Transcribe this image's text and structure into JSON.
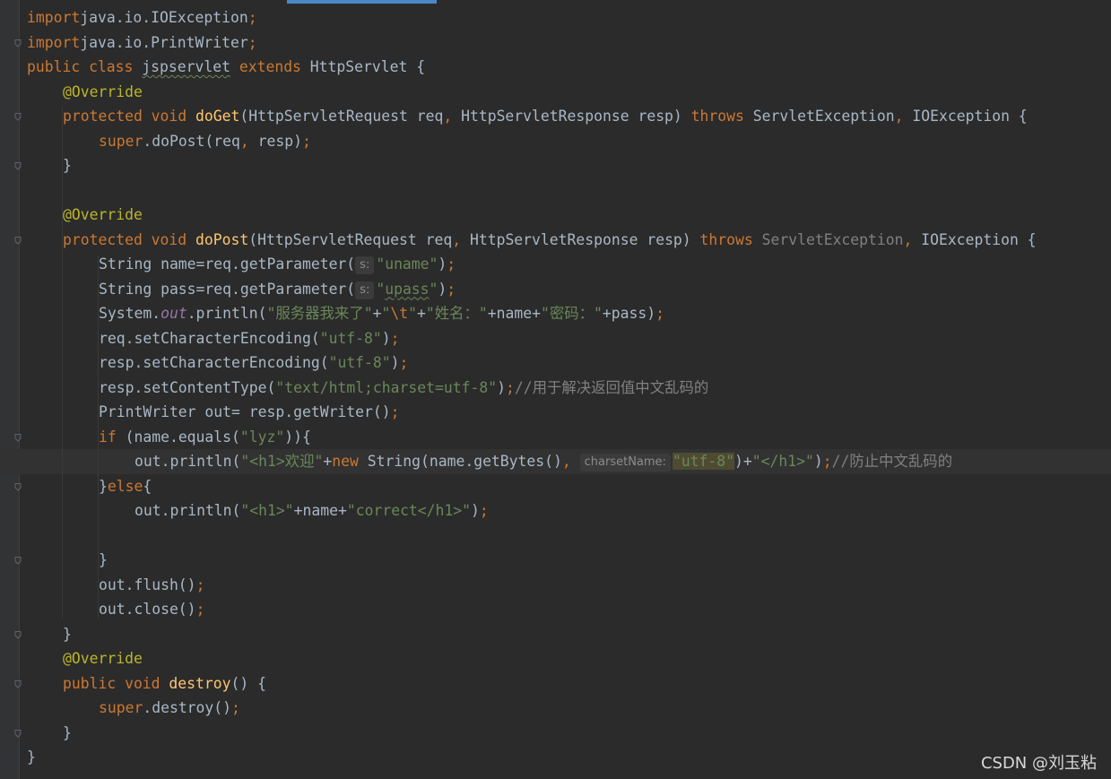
{
  "editor": {
    "lines": [
      [
        [
          "kw",
          "import"
        ],
        [
          "",
          "java.io.IOException"
        ],
        [
          "kw",
          ";"
        ]
      ],
      [
        [
          "kw",
          "import"
        ],
        [
          "",
          "java.io.PrintWriter"
        ],
        [
          "kw",
          ";"
        ]
      ],
      [
        [
          "kw",
          "public class "
        ],
        [
          "squig",
          "jspservlet"
        ],
        [
          "kw",
          " extends "
        ],
        [
          "",
          "HttpServlet {"
        ]
      ],
      [
        [
          "ann",
          "@Override"
        ]
      ],
      [
        [
          "kw",
          "protected void "
        ],
        [
          "fn",
          "doGet"
        ],
        [
          "",
          "(HttpServletRequest req"
        ],
        [
          "kw",
          ", "
        ],
        [
          "",
          "HttpServletResponse resp) "
        ],
        [
          "kw",
          "throws "
        ],
        [
          "",
          "ServletException"
        ],
        [
          "kw",
          ", "
        ],
        [
          "",
          "IOException {"
        ]
      ],
      [
        [
          "kw",
          "super"
        ],
        [
          "",
          ".doPost(req"
        ],
        [
          "kw",
          ", "
        ],
        [
          "",
          "resp)"
        ],
        [
          "kw",
          ";"
        ]
      ],
      [
        [
          "",
          "}"
        ]
      ],
      [],
      [
        [
          "ann",
          "@Override"
        ]
      ],
      [
        [
          "kw",
          "protected void "
        ],
        [
          "fn",
          "doPost"
        ],
        [
          "",
          "(HttpServletRequest req"
        ],
        [
          "kw",
          ", "
        ],
        [
          "",
          "HttpServletResponse resp) "
        ],
        [
          "kw",
          "throws "
        ],
        [
          "gray",
          "ServletException"
        ],
        [
          "kw",
          ", "
        ],
        [
          "",
          "IOException {"
        ]
      ],
      [
        [
          "",
          "String name=req.getParameter("
        ],
        [
          "hint",
          "s:"
        ],
        [
          "str",
          "\"uname\""
        ],
        [
          "",
          ")"
        ],
        [
          "kw",
          ";"
        ]
      ],
      [
        [
          "",
          "String pass=req.getParameter("
        ],
        [
          "hint",
          "s:"
        ],
        [
          "str",
          "\""
        ],
        [
          "str squig",
          "upass"
        ],
        [
          "str",
          "\""
        ],
        [
          "",
          ")"
        ],
        [
          "kw",
          ";"
        ]
      ],
      [
        [
          "",
          "System."
        ],
        [
          "fld",
          "out"
        ],
        [
          "",
          ".println("
        ],
        [
          "str",
          "\"服务器我来了\""
        ],
        [
          "",
          "+"
        ],
        [
          "str",
          "\""
        ],
        [
          "esc",
          "\\t"
        ],
        [
          "str",
          "\""
        ],
        [
          "",
          "+"
        ],
        [
          "str",
          "\"姓名：\""
        ],
        [
          "",
          "+name+"
        ],
        [
          "str",
          "\"密码：\""
        ],
        [
          "",
          "+pass)"
        ],
        [
          "kw",
          ";"
        ]
      ],
      [
        [
          "",
          "req.setCharacterEncoding("
        ],
        [
          "str",
          "\"utf-8\""
        ],
        [
          "",
          ")"
        ],
        [
          "kw",
          ";"
        ]
      ],
      [
        [
          "",
          "resp.setCharacterEncoding("
        ],
        [
          "str",
          "\"utf-8\""
        ],
        [
          "",
          ")"
        ],
        [
          "kw",
          ";"
        ]
      ],
      [
        [
          "",
          "resp.setContentType("
        ],
        [
          "str",
          "\"text/html;charset=utf-8\""
        ],
        [
          "",
          ")"
        ],
        [
          "kw",
          ";"
        ],
        [
          "cmt",
          "//用于解决返回值中文乱码的"
        ]
      ],
      [
        [
          "",
          "PrintWriter out= resp.getWriter()"
        ],
        [
          "kw",
          ";"
        ]
      ],
      [
        [
          "kw",
          "if "
        ],
        [
          "",
          "(name.equals("
        ],
        [
          "str",
          "\"lyz\""
        ],
        [
          "",
          "))"
        ],
        [
          "",
          "{"
        ]
      ],
      [
        [
          "",
          "out.println("
        ],
        [
          "str",
          "\"<h1>欢迎\""
        ],
        [
          "",
          "+"
        ],
        [
          "kw",
          "new "
        ],
        [
          "",
          "String(name.getBytes()"
        ],
        [
          "kw",
          ", "
        ],
        [
          "hint",
          "charsetName:"
        ],
        [
          "str hl",
          "\"utf-8\""
        ],
        [
          "",
          ")+"
        ],
        [
          "str",
          "\"</h1>\""
        ],
        [
          "",
          ")"
        ],
        [
          "kw",
          ";"
        ],
        [
          "cmt",
          "//防止中文乱码的"
        ]
      ],
      [
        [
          "",
          "}"
        ],
        [
          "kw",
          "else"
        ],
        [
          "",
          "{"
        ]
      ],
      [
        [
          "",
          "out.println("
        ],
        [
          "str",
          "\"<h1>\""
        ],
        [
          "",
          "+name+"
        ],
        [
          "str",
          "\"correct</h1>\""
        ],
        [
          "",
          ")"
        ],
        [
          "kw",
          ";"
        ]
      ],
      [],
      [
        [
          "",
          "}"
        ]
      ],
      [
        [
          "",
          "out.flush()"
        ],
        [
          "kw",
          ";"
        ]
      ],
      [
        [
          "",
          "out.close()"
        ],
        [
          "kw",
          ";"
        ]
      ],
      [
        [
          "",
          "}"
        ]
      ],
      [
        [
          "ann",
          "@Override"
        ]
      ],
      [
        [
          "kw",
          "public void "
        ],
        [
          "fn",
          "destroy"
        ],
        [
          "",
          "() {"
        ]
      ],
      [
        [
          "kw",
          "super"
        ],
        [
          "",
          ".destroy()"
        ],
        [
          "kw",
          ";"
        ]
      ],
      [
        [
          "",
          "}"
        ]
      ],
      [
        [
          "",
          "}"
        ]
      ]
    ],
    "current_line": 18
  },
  "watermark": "CSDN @刘玉粘",
  "colors": {
    "background": "#2b2b2b",
    "keyword": "#cc7832",
    "string": "#6a8759",
    "annotation": "#bbb529",
    "method": "#ffc66d",
    "field": "#9876aa",
    "comment": "#808080",
    "text": "#a9b7c6"
  }
}
